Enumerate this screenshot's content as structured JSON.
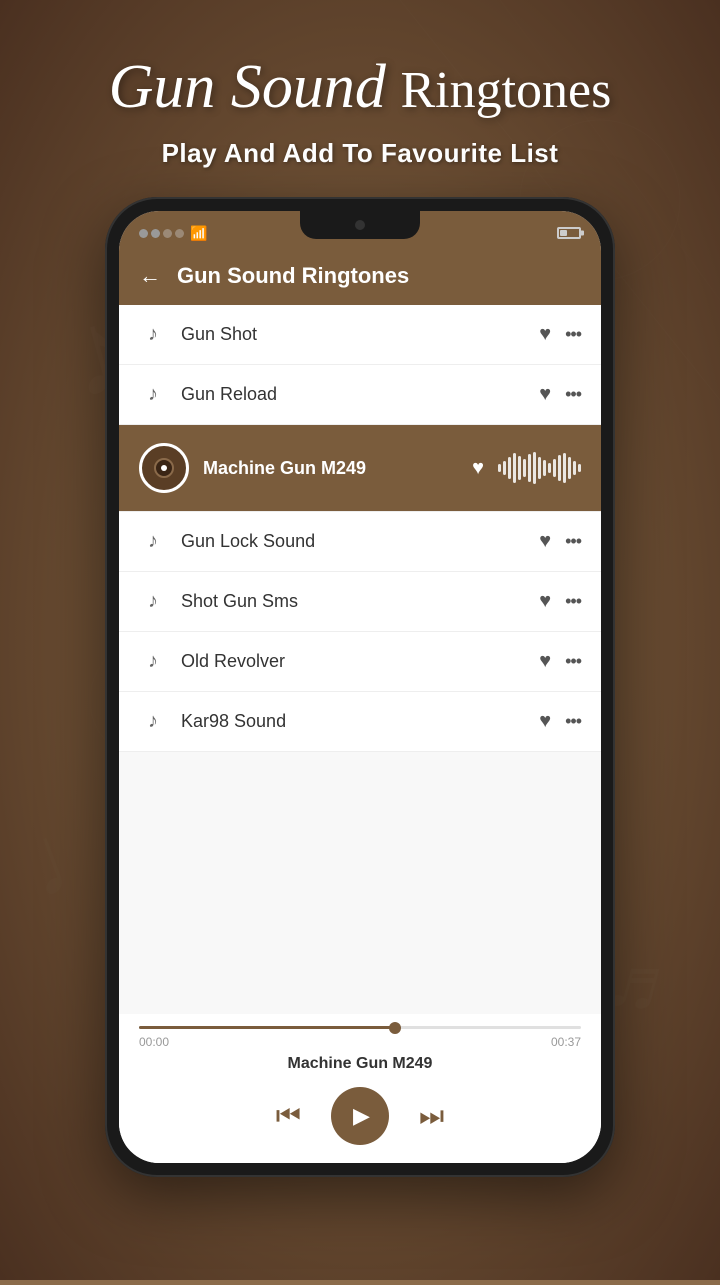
{
  "app": {
    "title_cursive": "Gun Sound",
    "title_regular": "Ringtones",
    "subtitle": "Play And Add To Favourite List"
  },
  "status_bar": {
    "battery_percent": "45%",
    "time": ""
  },
  "screen": {
    "header_title": "Gun Sound Ringtones",
    "back_label": "←"
  },
  "ringtones": [
    {
      "id": 1,
      "name": "Gun Shot",
      "playing": false,
      "favorited": true
    },
    {
      "id": 2,
      "name": "Gun Reload",
      "playing": false,
      "favorited": true
    },
    {
      "id": 3,
      "name": "Machine Gun M249",
      "playing": true,
      "favorited": true
    },
    {
      "id": 4,
      "name": "Gun Lock Sound",
      "playing": false,
      "favorited": true
    },
    {
      "id": 5,
      "name": "Shot Gun Sms",
      "playing": false,
      "favorited": true
    },
    {
      "id": 6,
      "name": "Old Revolver",
      "playing": false,
      "favorited": true
    },
    {
      "id": 7,
      "name": "Kar98 Sound",
      "playing": false,
      "favorited": true
    }
  ],
  "player": {
    "song_name": "Machine Gun M249",
    "time_current": "00:00",
    "time_total": "00:37",
    "progress_pct": 58
  },
  "waveform_heights": [
    8,
    14,
    20,
    28,
    22,
    18,
    26,
    30,
    24,
    16,
    10,
    14,
    22,
    28,
    20,
    14,
    8
  ]
}
